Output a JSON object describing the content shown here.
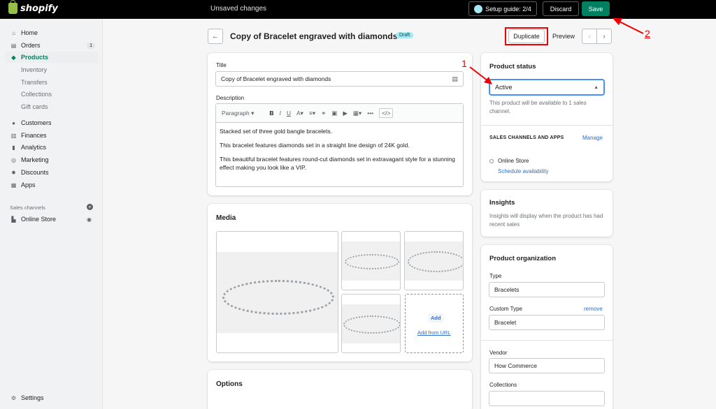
{
  "topbar": {
    "logo_text": "shopify",
    "status": "Unsaved changes",
    "setup_guide": "Setup guide: 2/4",
    "discard": "Discard",
    "save": "Save"
  },
  "sidebar": {
    "items": [
      {
        "label": "Home"
      },
      {
        "label": "Orders",
        "badge": "1"
      },
      {
        "label": "Products"
      },
      {
        "label": "Inventory"
      },
      {
        "label": "Transfers"
      },
      {
        "label": "Collections"
      },
      {
        "label": "Gift cards"
      },
      {
        "label": "Customers"
      },
      {
        "label": "Finances"
      },
      {
        "label": "Analytics"
      },
      {
        "label": "Marketing"
      },
      {
        "label": "Discounts"
      },
      {
        "label": "Apps"
      }
    ],
    "sales_channels_heading": "Sales channels",
    "online_store": "Online Store",
    "settings": "Settings"
  },
  "header": {
    "title": "Copy of Bracelet engraved with diamonds",
    "status_badge": "Draft",
    "duplicate": "Duplicate",
    "preview": "Preview"
  },
  "product": {
    "title_label": "Title",
    "title_value": "Copy of Bracelet engraved with diamonds",
    "description_label": "Description",
    "toolbar_paragraph": "Paragraph",
    "description_lines": [
      "Stacked set of three gold bangle bracelets.",
      "This bracelet features diamonds set in a straight line design of 24K gold.",
      "This beautiful bracelet features round-cut diamonds set in extravagant style for a stunning effect making you look like a VIP."
    ]
  },
  "media": {
    "heading": "Media",
    "add": "Add",
    "add_from_url": "Add from URL"
  },
  "options": {
    "heading": "Options"
  },
  "status_card": {
    "heading": "Product status",
    "selected": "Active",
    "help": "This product will be available to 1 sales channel.",
    "channels_heading": "SALES CHANNELS AND APPS",
    "manage": "Manage",
    "channel": "Online Store",
    "schedule": "Schedule availability"
  },
  "insights": {
    "heading": "Insights",
    "text": "Insights will display when the product has had recent sales"
  },
  "organization": {
    "heading": "Product organization",
    "type_label": "Type",
    "type_value": "Bracelets",
    "custom_type_label": "Custom Type",
    "remove": "remove",
    "custom_type_value": "Bracelet",
    "vendor_label": "Vendor",
    "vendor_value": "How Commerce",
    "collections_label": "Collections"
  },
  "annotations": {
    "one": "1",
    "two": "2"
  },
  "colors": {
    "accent": "#008060",
    "annotation": "#e00000",
    "focus": "#458fff"
  }
}
